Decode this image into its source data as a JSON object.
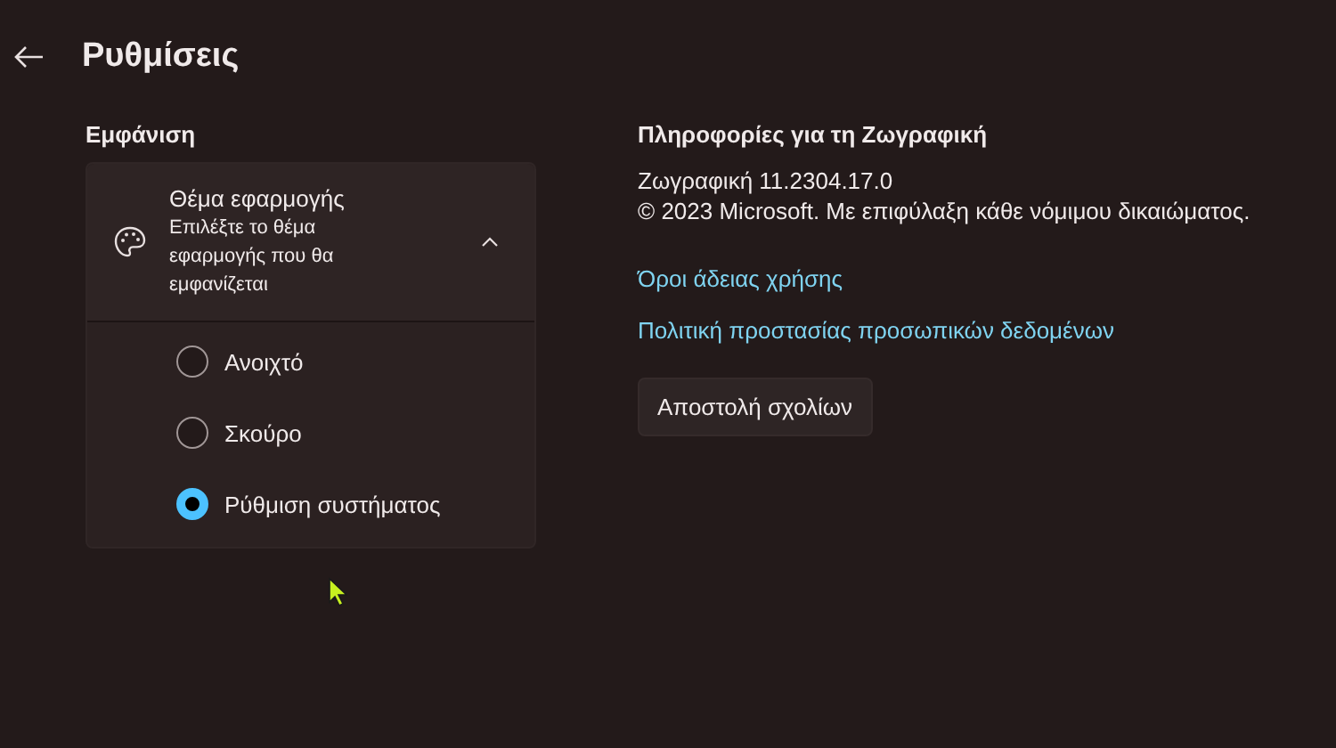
{
  "header": {
    "title": "Ρυθμίσεις"
  },
  "appearance": {
    "label": "Εμφάνιση",
    "theme": {
      "title": "Θέμα εφαρμογής",
      "description": "Επιλέξτε το θέμα εφαρμογής που θα εμφανίζεται",
      "expanded": true,
      "options": [
        {
          "label": "Ανοιχτό",
          "selected": false
        },
        {
          "label": "Σκούρο",
          "selected": false
        },
        {
          "label": "Ρύθμιση συστήματος",
          "selected": true
        }
      ]
    }
  },
  "about": {
    "title": "Πληροφορίες για τη Ζωγραφική",
    "version": "Ζωγραφική 11.2304.17.0",
    "copyright": "© 2023 Microsoft. Με επιφύλαξη κάθε νόμιμου δικαιώματος.",
    "links": [
      "Όροι άδειας χρήσης",
      "Πολιτική προστασίας προσωπικών δεδομένων"
    ],
    "button": "Αποστολή σχολίων"
  }
}
